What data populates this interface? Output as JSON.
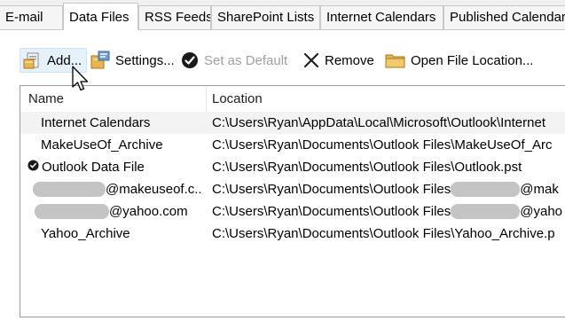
{
  "tabs": [
    {
      "label": "E-mail",
      "active": false
    },
    {
      "label": "Data Files",
      "active": true
    },
    {
      "label": "RSS Feeds",
      "active": false
    },
    {
      "label": "SharePoint Lists",
      "active": false
    },
    {
      "label": "Internet Calendars",
      "active": false
    },
    {
      "label": "Published Calendars",
      "active": false
    }
  ],
  "toolbar": {
    "add_label": "Add...",
    "settings_label": "Settings...",
    "set_default_label": "Set as Default",
    "remove_label": "Remove",
    "open_location_label": "Open File Location..."
  },
  "table": {
    "columns": [
      "Name",
      "Location"
    ],
    "rows": [
      {
        "name": "Internet Calendars",
        "location": "C:\\Users\\Ryan\\AppData\\Local\\Microsoft\\Outlook\\Internet",
        "default": false,
        "selected": true
      },
      {
        "name": "MakeUseOf_Archive",
        "location": "C:\\Users\\Ryan\\Documents\\Outlook Files\\MakeUseOf_Arc",
        "default": false,
        "selected": false
      },
      {
        "name": "Outlook Data File",
        "location": "C:\\Users\\Ryan\\Documents\\Outlook Files\\Outlook.pst",
        "default": true,
        "selected": false
      },
      {
        "name": "@makeuseof.c...",
        "location": "C:\\Users\\Ryan\\Documents\\Outlook Files",
        "location_suffix": "@mak",
        "default": false,
        "selected": false,
        "redacted": true
      },
      {
        "name": "@yahoo.com",
        "location": "C:\\Users\\Ryan\\Documents\\Outlook Files",
        "location_suffix": "@yaho",
        "default": false,
        "selected": false,
        "redacted": true
      },
      {
        "name": "Yahoo_Archive",
        "location": "C:\\Users\\Ryan\\Documents\\Outlook Files\\Yahoo_Archive.p",
        "default": false,
        "selected": false
      }
    ]
  }
}
